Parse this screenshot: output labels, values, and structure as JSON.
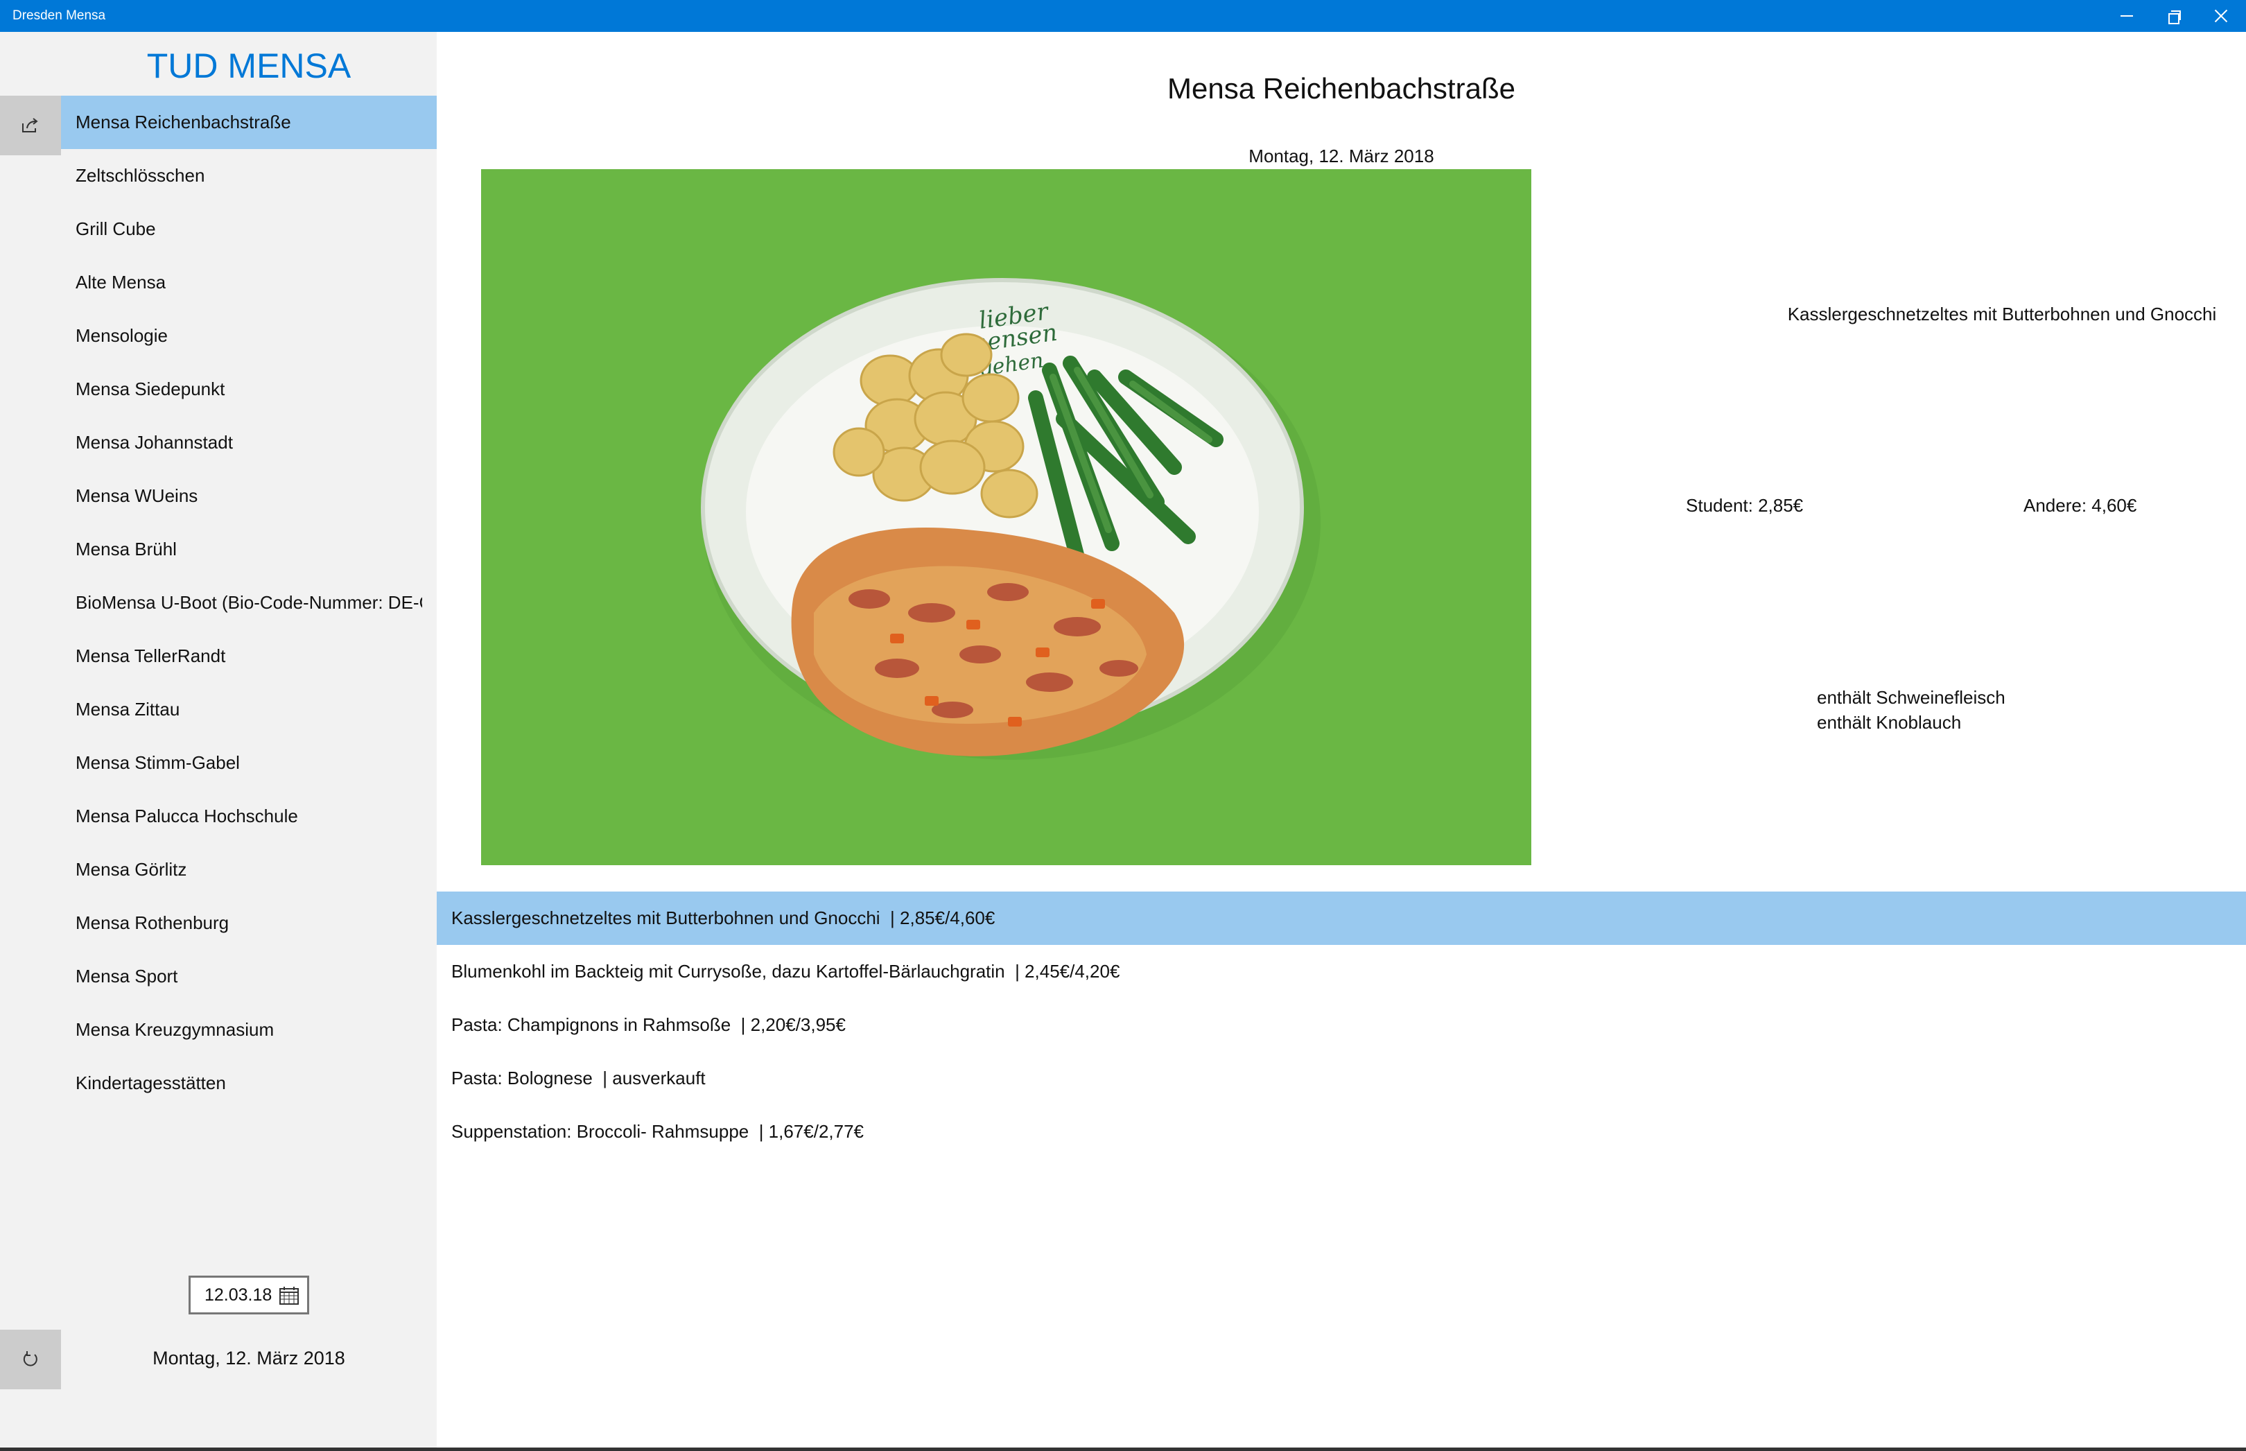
{
  "window": {
    "title": "Dresden Mensa",
    "controls": [
      "minimize-icon",
      "restore-icon",
      "close-icon"
    ]
  },
  "colors": {
    "titlebar": "#0078d7",
    "accent": "#0078d7",
    "selected_row": "#99c9ef",
    "sidebar_bg": "#f2f2f2",
    "rail_button": "#cccccc"
  },
  "sidebar": {
    "brand": "TUD MENSA",
    "share_icon": "share-icon",
    "refresh_icon": "refresh-icon",
    "items": [
      {
        "label": "Mensa Reichenbachstraße",
        "selected": true
      },
      {
        "label": "Zeltschlösschen"
      },
      {
        "label": "Grill Cube"
      },
      {
        "label": "Alte Mensa"
      },
      {
        "label": "Mensologie"
      },
      {
        "label": "Mensa Siedepunkt"
      },
      {
        "label": "Mensa Johannstadt"
      },
      {
        "label": "Mensa WUeins"
      },
      {
        "label": "Mensa Brühl"
      },
      {
        "label": "BioMensa U-Boot (Bio-Code-Nummer: DE-ÖKO-"
      },
      {
        "label": "Mensa TellerRandt"
      },
      {
        "label": "Mensa Zittau"
      },
      {
        "label": "Mensa Stimm-Gabel"
      },
      {
        "label": "Mensa Palucca Hochschule"
      },
      {
        "label": "Mensa Görlitz"
      },
      {
        "label": "Mensa Rothenburg"
      },
      {
        "label": "Mensa Sport"
      },
      {
        "label": "Mensa Kreuzgymnasium"
      },
      {
        "label": "Kindertagesstätten"
      }
    ],
    "date_picker_value": "12.03.18",
    "date_picker_icon": "calendar-icon",
    "date_label": "Montag, 12. März 2018"
  },
  "main": {
    "title": "Mensa Reichenbachstraße",
    "date": "Montag, 12. März 2018",
    "detail": {
      "name": "Kasslergeschnetzeltes mit Butterbohnen und Gnocchi",
      "price_student": "Student: 2,85€",
      "price_other": "Andere: 4,60€",
      "notes": [
        "enthält Schweinefleisch",
        "enthält Knoblauch"
      ],
      "photo_plate_text": [
        "lieber",
        "mensen",
        "gehen"
      ]
    },
    "meals": [
      {
        "text": "Kasslergeschnetzeltes mit Butterbohnen und Gnocchi  | 2,85€/4,60€",
        "selected": true
      },
      {
        "text": "Blumenkohl im Backteig mit Currysoße, dazu Kartoffel-Bärlauchgratin  | 2,45€/4,20€"
      },
      {
        "text": "Pasta: Champignons in Rahmsoße  | 2,20€/3,95€"
      },
      {
        "text": "Pasta: Bolognese  | ausverkauft"
      },
      {
        "text": "Suppenstation: Broccoli- Rahmsuppe  | 1,67€/2,77€"
      }
    ]
  }
}
